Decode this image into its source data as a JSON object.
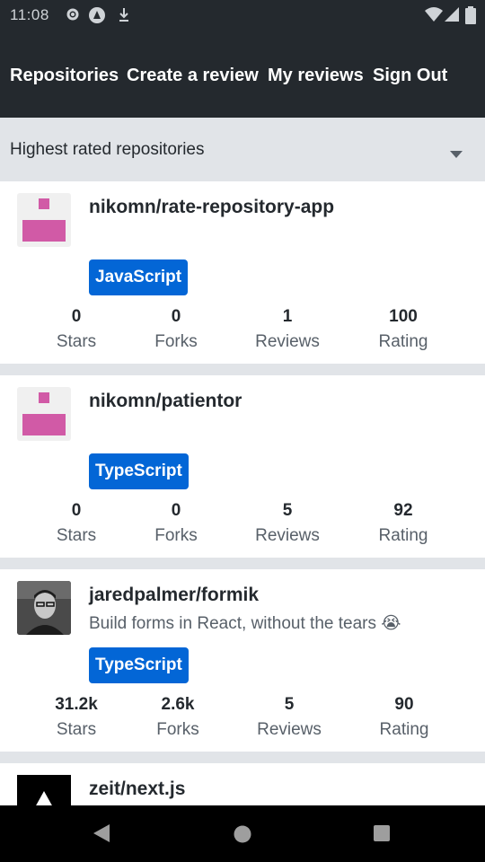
{
  "status_bar": {
    "time": "11:08",
    "icons": [
      "gear-icon",
      "app-icon",
      "download-icon",
      "wifi-icon",
      "signal-icon",
      "battery-icon"
    ]
  },
  "app_bar": {
    "tabs": [
      "Repositories",
      "Create a review",
      "My reviews",
      "Sign Out"
    ]
  },
  "sorter": {
    "selected": "Highest rated repositories"
  },
  "repositories": [
    {
      "full_name": "nikomn/rate-repository-app",
      "description": "",
      "language": "JavaScript",
      "avatar": "identicon",
      "stats": [
        {
          "value": "0",
          "label": "Stars"
        },
        {
          "value": "0",
          "label": "Forks"
        },
        {
          "value": "1",
          "label": "Reviews"
        },
        {
          "value": "100",
          "label": "Rating"
        }
      ]
    },
    {
      "full_name": "nikomn/patientor",
      "description": "",
      "language": "TypeScript",
      "avatar": "identicon",
      "stats": [
        {
          "value": "0",
          "label": "Stars"
        },
        {
          "value": "0",
          "label": "Forks"
        },
        {
          "value": "5",
          "label": "Reviews"
        },
        {
          "value": "92",
          "label": "Rating"
        }
      ]
    },
    {
      "full_name": "jaredpalmer/formik",
      "description": "Build forms in React, without the tears 😭",
      "language": "TypeScript",
      "avatar": "user-photo",
      "stats": [
        {
          "value": "31.2k",
          "label": "Stars"
        },
        {
          "value": "2.6k",
          "label": "Forks"
        },
        {
          "value": "5",
          "label": "Reviews"
        },
        {
          "value": "90",
          "label": "Rating"
        }
      ]
    },
    {
      "full_name": "zeit/next.js",
      "avatar": "vercel-logo"
    }
  ],
  "colors": {
    "app_bar": "#24292e",
    "background": "#e1e4e8",
    "language_badge": "#0366d6",
    "identicon": "#d15aa6"
  }
}
